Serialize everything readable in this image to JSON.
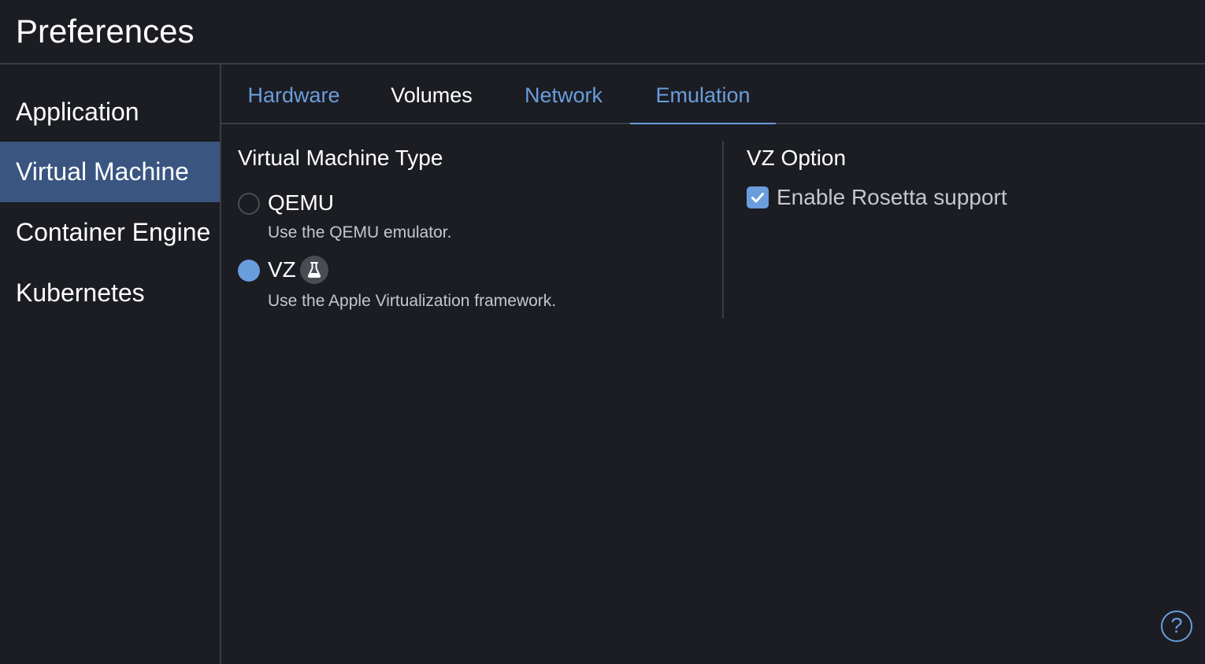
{
  "header": {
    "title": "Preferences"
  },
  "sidebar": {
    "items": [
      {
        "label": "Application",
        "active": false
      },
      {
        "label": "Virtual Machine",
        "active": true
      },
      {
        "label": "Container Engine",
        "active": false
      },
      {
        "label": "Kubernetes",
        "active": false
      }
    ]
  },
  "tabs": [
    {
      "label": "Hardware",
      "active": false
    },
    {
      "label": "Volumes",
      "active": false
    },
    {
      "label": "Network",
      "active": false
    },
    {
      "label": "Emulation",
      "active": true
    }
  ],
  "vm_type": {
    "title": "Virtual Machine Type",
    "options": [
      {
        "label": "QEMU",
        "description": "Use the QEMU emulator.",
        "selected": false
      },
      {
        "label": "VZ",
        "description": "Use the Apple Virtualization framework.",
        "selected": true,
        "badge_icon": "flask-icon"
      }
    ]
  },
  "vz_option": {
    "title": "VZ Option",
    "rosetta_label": "Enable Rosetta support",
    "rosetta_checked": true
  },
  "help": {
    "symbol": "?"
  },
  "colors": {
    "background": "#1b1d23",
    "accent": "#6a9ddc",
    "active_nav": "#395580",
    "divider": "#3b3d44"
  }
}
